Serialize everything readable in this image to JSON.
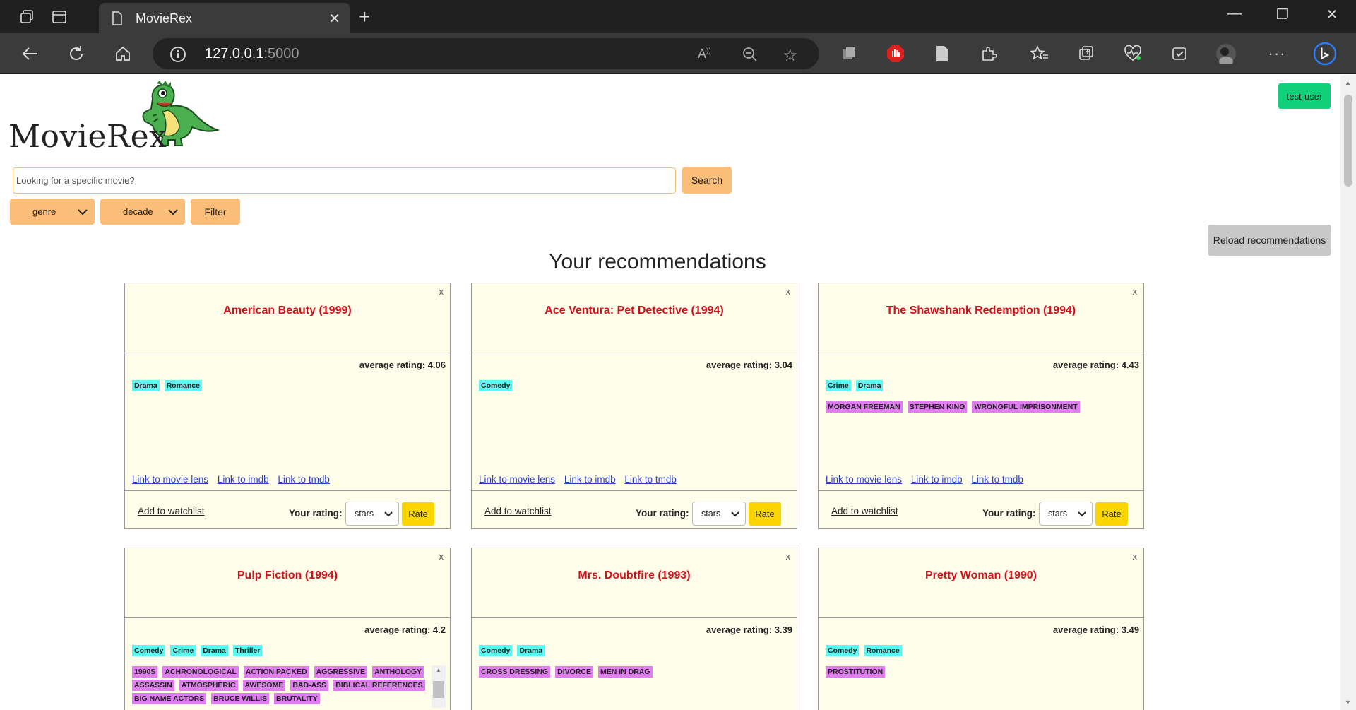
{
  "browser": {
    "tab_title": "MovieRex",
    "url_host": "127.0.0.1",
    "url_port": ":5000"
  },
  "app": {
    "logo_text": "MovieRex",
    "user_button": "test-user",
    "search_placeholder": "Looking for a specific movie?",
    "search_button": "Search",
    "genre_select": "genre",
    "decade_select": "decade",
    "filter_button": "Filter",
    "reload_button": "Reload recommendations",
    "section_title": "Your recommendations"
  },
  "card_labels": {
    "close": "x",
    "link_movielens": "Link to movie lens",
    "link_imdb": "Link to imdb",
    "link_tmdb": "Link to tmdb",
    "add_watchlist": "Add to watchlist",
    "your_rating": "Your rating:",
    "stars": "stars",
    "rate": "Rate"
  },
  "movies": [
    {
      "title": "American Beauty (1999)",
      "avg": "average rating: 4.06",
      "genres": [
        "Drama",
        "Romance"
      ],
      "keywords": []
    },
    {
      "title": "Ace Ventura: Pet Detective (1994)",
      "avg": "average rating: 3.04",
      "genres": [
        "Comedy"
      ],
      "keywords": []
    },
    {
      "title": "The Shawshank Redemption (1994)",
      "avg": "average rating: 4.43",
      "genres": [
        "Crime",
        "Drama"
      ],
      "keywords": [
        "MORGAN FREEMAN",
        "STEPHEN KING",
        "WRONGFUL IMPRISONMENT"
      ]
    },
    {
      "title": "Pulp Fiction (1994)",
      "avg": "average rating: 4.2",
      "genres": [
        "Comedy",
        "Crime",
        "Drama",
        "Thriller"
      ],
      "keywords": [
        "1990S",
        "ACHRONOLOGICAL",
        "ACTION PACKED",
        "AGGRESSIVE",
        "ANTHOLOGY",
        "ASSASSIN",
        "ATMOSPHERIC",
        "AWESOME",
        "BAD-ASS",
        "BIBLICAL REFERENCES",
        "BIG NAME ACTORS",
        "BRUCE WILLIS",
        "BRUTALITY"
      ]
    },
    {
      "title": "Mrs. Doubtfire (1993)",
      "avg": "average rating: 3.39",
      "genres": [
        "Comedy",
        "Drama"
      ],
      "keywords": [
        "CROSS DRESSING",
        "DIVORCE",
        "MEN IN DRAG"
      ]
    },
    {
      "title": "Pretty Woman (1990)",
      "avg": "average rating: 3.49",
      "genres": [
        "Comedy",
        "Romance"
      ],
      "keywords": [
        "PROSTITUTION"
      ]
    }
  ]
}
